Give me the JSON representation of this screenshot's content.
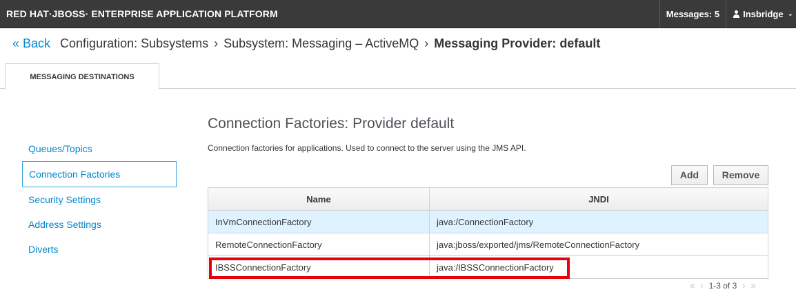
{
  "header": {
    "brand": "RED HAT·JBOSS· ENTERPRISE APPLICATION PLATFORM",
    "messages": "Messages: 5",
    "user": "Insbridge"
  },
  "breadcrumb": {
    "back": "« Back",
    "items": [
      "Configuration: Subsystems",
      "Subsystem: Messaging – ActiveMQ"
    ],
    "current": "Messaging Provider: default",
    "separator": "›"
  },
  "tab": {
    "label": "MESSAGING DESTINATIONS"
  },
  "nav": {
    "items": [
      {
        "label": "Queues/Topics"
      },
      {
        "label": "Connection Factories"
      },
      {
        "label": "Security Settings"
      },
      {
        "label": "Address Settings"
      },
      {
        "label": "Diverts"
      }
    ]
  },
  "main": {
    "title": "Connection Factories: Provider default",
    "description": "Connection factories for applications. Used to connect to the server using the JMS API.",
    "add_label": "Add",
    "remove_label": "Remove",
    "table": {
      "headers": [
        "Name",
        "JNDI"
      ],
      "rows": [
        {
          "name": "InVmConnectionFactory",
          "jndi": "java:/ConnectionFactory"
        },
        {
          "name": "RemoteConnectionFactory",
          "jndi": "java:jboss/exported/jms/RemoteConnectionFactory"
        },
        {
          "name": "IBSSConnectionFactory",
          "jndi": "java:/IBSSConnectionFactory"
        }
      ]
    },
    "pager": {
      "first": "«",
      "prev": "‹",
      "range": "1-3 of 3",
      "next": "›",
      "last": "»"
    }
  },
  "colors": {
    "header_bg": "#3a3a3a",
    "link": "#0088ce",
    "selected_row": "#def3ff",
    "highlight_box": "#e8000b"
  }
}
